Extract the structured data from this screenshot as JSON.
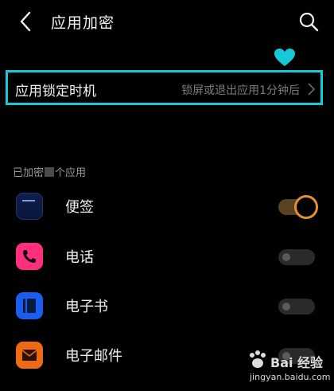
{
  "header": {
    "title": "应用加密"
  },
  "lock_timing": {
    "label": "应用锁定时机",
    "value": "锁屏或退出应用1分钟后"
  },
  "section": {
    "label_prefix": "已加密",
    "label_suffix": "个应用"
  },
  "apps": [
    {
      "name": "便签",
      "icon": "notes-icon",
      "enabled": true,
      "color": "#0f1e50"
    },
    {
      "name": "电话",
      "icon": "phone-icon",
      "enabled": false,
      "color": "#ff2f7d"
    },
    {
      "name": "电子书",
      "icon": "ebook-icon",
      "enabled": false,
      "color": "#1b5df0"
    },
    {
      "name": "电子邮件",
      "icon": "mail-icon",
      "enabled": false,
      "color": "#f06a14"
    }
  ],
  "watermark": {
    "name": "Bai 经验",
    "url": "jingyan.baidu.com"
  },
  "colors": {
    "highlight": "#17c9d8",
    "toggle_on": "#e0922f",
    "background": "#000000"
  }
}
